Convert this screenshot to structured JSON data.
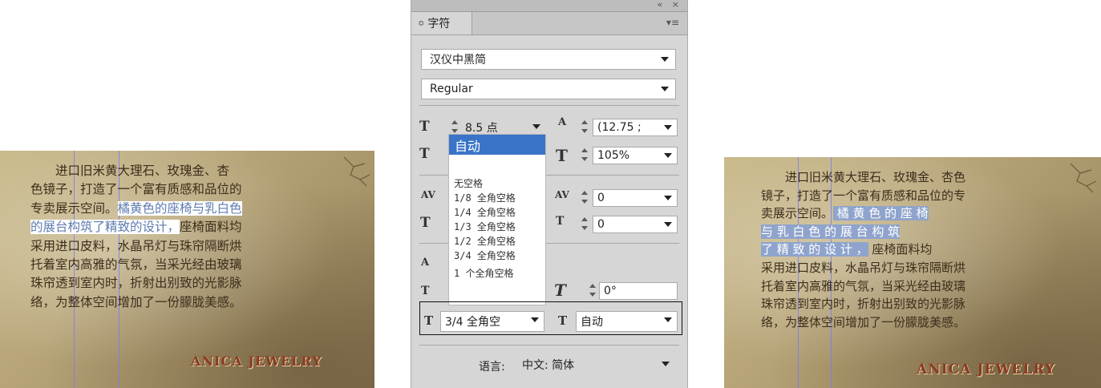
{
  "left_sample": {
    "lines": [
      {
        "pre": "　　进口旧米黄大理石、玫瑰金、杏",
        "hl": "",
        "post": ""
      },
      {
        "pre": "色镜子，打造了一个富有质感和品位的",
        "hl": "",
        "post": ""
      },
      {
        "pre": "专卖展示空间。",
        "hl": "橘黄色的座椅与乳白色",
        "post": ""
      },
      {
        "pre": "",
        "hl": "的展台构筑了精致的设计，",
        "post": "座椅面料均"
      },
      {
        "pre": "采用进口皮料，水晶吊灯与珠帘隔断烘",
        "hl": "",
        "post": ""
      },
      {
        "pre": "托着室内高雅的气氛，当采光经由玻璃",
        "hl": "",
        "post": ""
      },
      {
        "pre": "珠帘透到室内时，折射出别致的光影脉",
        "hl": "",
        "post": ""
      },
      {
        "pre": "络，为整体空间增加了一份朦胧美感。",
        "hl": "",
        "post": ""
      }
    ],
    "brand": "ANICA JEWELRY"
  },
  "right_sample": {
    "lines": [
      {
        "pre": "　　进口旧米黄大理石、玫瑰金、杏色",
        "hl": "",
        "post": ""
      },
      {
        "pre": "镜子，打造了一个富有质感和品位的专",
        "hl": "",
        "post": ""
      },
      {
        "pre": "卖展示空间。",
        "hl": " 橘 黄 色 的 座 椅",
        "post": ""
      },
      {
        "pre": "",
        "hl": " 与 乳 白 色 的 展 台 构 筑 ",
        "post": ""
      },
      {
        "pre": "",
        "hl": " 了 精 致 的 设 计 ，",
        "post": " 座椅面料均"
      },
      {
        "pre": "采用进口皮料，水晶吊灯与珠帘隔断烘",
        "hl": "",
        "post": ""
      },
      {
        "pre": "托着室内高雅的气氛，当采光经由玻璃",
        "hl": "",
        "post": ""
      },
      {
        "pre": "珠帘透到室内时，折射出别致的光影脉",
        "hl": "",
        "post": ""
      },
      {
        "pre": "络，为整体空间增加了一份朦胧美感。",
        "hl": "",
        "post": ""
      }
    ],
    "brand": "ANICA JEWELRY"
  },
  "panel": {
    "titlebar_buttons": "«  ×",
    "tab_arrow": "≎",
    "tab_label": "字符",
    "menu_icon": "▾≡",
    "font_family": "汉仪中黑简",
    "font_style": "Regular",
    "font_size": "8.5 点",
    "leading": "(12.75",
    "leading_suffix": ";",
    "vertical_scale": "105%",
    "kerning": "0",
    "tsume": "0",
    "rotation": "0°",
    "mojikumi_before": "3/4 全角空",
    "mojikumi_after": "自动",
    "language_label": "语言:",
    "language_value": "中文: 简体",
    "icons": {
      "size": "T",
      "leading": "A",
      "vscale": "T",
      "hscale": "T",
      "kern": "AV",
      "track": "AV",
      "tsume": "T",
      "aki": "T",
      "baseline": "A",
      "charrot": "T",
      "skew": "T",
      "before": "T",
      "after": "T"
    }
  },
  "dropdown": {
    "selected": "自动",
    "options": [
      "无空格",
      "1/8 全角空格",
      "1/4 全角空格",
      "1/3 全角空格",
      "1/2 全角空格",
      "3/4 全角空格",
      "1 个全角空格"
    ]
  }
}
